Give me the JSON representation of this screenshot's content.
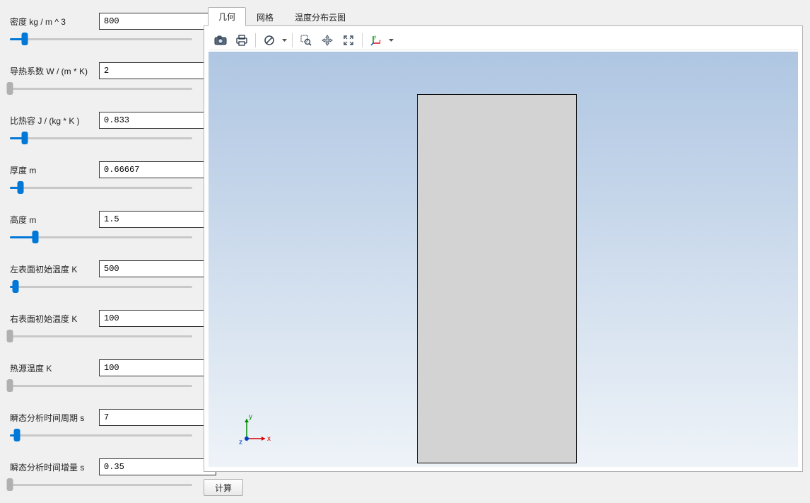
{
  "fields": [
    {
      "label": "密度 kg / m ^ 3",
      "value": "800",
      "slider_pct": 8,
      "enabled": true
    },
    {
      "label": "导热系数 W / (m * K)",
      "value": "2",
      "slider_pct": 0,
      "enabled": false
    },
    {
      "label": "比热容 J / (kg * K )",
      "value": "0.833",
      "slider_pct": 8,
      "enabled": true
    },
    {
      "label": "厚度 m",
      "value": "0.66667",
      "slider_pct": 6,
      "enabled": true
    },
    {
      "label": "高度 m",
      "value": "1.5",
      "slider_pct": 14,
      "enabled": true
    },
    {
      "label": "左表面初始温度 K",
      "value": "500",
      "slider_pct": 3,
      "enabled": true
    },
    {
      "label": "右表面初始温度 K",
      "value": "100",
      "slider_pct": 0,
      "enabled": false
    },
    {
      "label": "热源温度  K",
      "value": "100",
      "slider_pct": 0,
      "enabled": false
    },
    {
      "label": "瞬态分析时间周期 s",
      "value": "7",
      "slider_pct": 4,
      "enabled": true
    },
    {
      "label": "瞬态分析时间增量 s",
      "value": "0.35",
      "slider_pct": 0,
      "enabled": false
    }
  ],
  "tabs": [
    {
      "label": "几何",
      "active": true
    },
    {
      "label": "网格",
      "active": false
    },
    {
      "label": "温度分布云图",
      "active": false
    }
  ],
  "toolbar": {
    "buttons": [
      {
        "name": "camera-icon"
      },
      {
        "name": "print-icon"
      },
      {
        "sep": true
      },
      {
        "name": "no-symbol-icon",
        "drop": true
      },
      {
        "sep": true
      },
      {
        "name": "zoom-box-icon"
      },
      {
        "name": "pan-icon"
      },
      {
        "name": "zoom-extents-icon"
      },
      {
        "sep": true
      },
      {
        "name": "axes-icon",
        "drop": true
      }
    ]
  },
  "axis_labels": {
    "x": "x",
    "y": "y",
    "z": "z"
  },
  "compute_label": "计算"
}
